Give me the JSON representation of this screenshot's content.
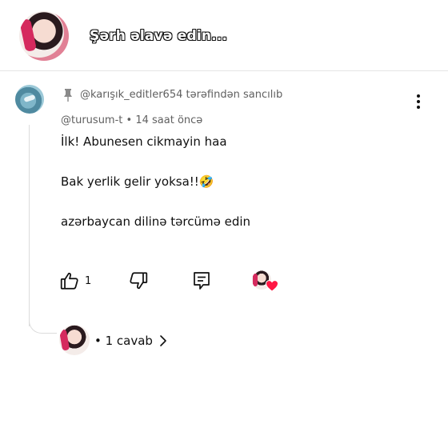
{
  "composer": {
    "prompt": "Şərh əlavə edin..."
  },
  "comment": {
    "pinned_label": "@karışık_editler654 tərəfindən sancılıb",
    "author": "@turusum-t",
    "separator": " • ",
    "time": "14 saat öncə",
    "lines": [
      "İlk! Abunesen cikmayin haa",
      "Bak yerlik gelir yoksa!!🤣",
      "azərbaycan dilinə tərcümə edin"
    ],
    "like_count": "1",
    "icons": {
      "pin": "pin-icon",
      "more": "more-vertical-icon",
      "like": "thumb-up-icon",
      "dislike": "thumb-down-icon",
      "reply": "reply-icon",
      "creator_heart": "heart-icon"
    },
    "heart_color": "#ff1744"
  },
  "replies": {
    "label": "• 1 cavab"
  }
}
